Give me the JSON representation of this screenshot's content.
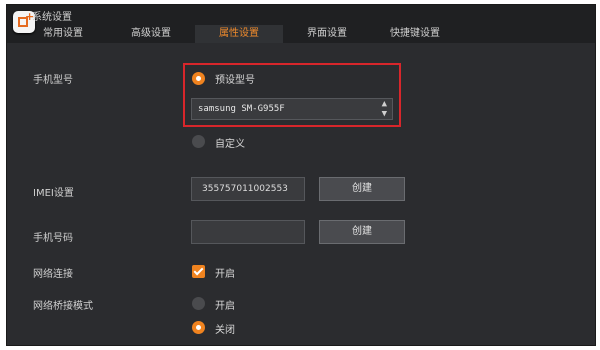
{
  "window": {
    "title": "系统设置"
  },
  "tabs": [
    {
      "label": "常用设置",
      "active": false
    },
    {
      "label": "高级设置",
      "active": false
    },
    {
      "label": "属性设置",
      "active": true
    },
    {
      "label": "界面设置",
      "active": false
    },
    {
      "label": "快捷键设置",
      "active": false
    }
  ],
  "phone_model": {
    "label": "手机型号",
    "preset_option": "预设型号",
    "preset_selected": true,
    "select_value": "samsung SM-G955F",
    "custom_option": "自定义",
    "custom_selected": false
  },
  "imei": {
    "label": "IMEI设置",
    "value": "355757011002553",
    "button": "创建"
  },
  "phone_number": {
    "label": "手机号码",
    "value": "",
    "button": "创建"
  },
  "network": {
    "label": "网络连接",
    "checkbox_label": "开启",
    "checked": true
  },
  "bridge": {
    "label": "网络桥接模式",
    "on_label": "开启",
    "on_selected": false,
    "off_label": "关闭",
    "off_selected": true
  },
  "colors": {
    "accent": "#f0831f",
    "highlight": "#d8262b",
    "panel": "#2b2c2f"
  }
}
